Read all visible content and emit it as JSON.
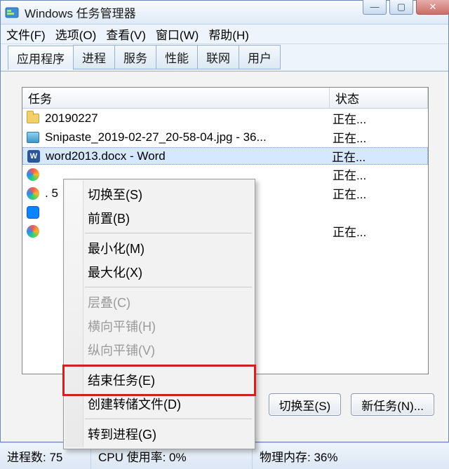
{
  "titlebar": {
    "title": "Windows 任务管理器"
  },
  "menubar": {
    "file": "文件(F)",
    "options": "选项(O)",
    "view": "查看(V)",
    "window": "窗口(W)",
    "help": "帮助(H)"
  },
  "tabs": {
    "apps": "应用程序",
    "procs": "进程",
    "services": "服务",
    "perf": "性能",
    "net": "联网",
    "users": "用户"
  },
  "columns": {
    "task": "任务",
    "state": "状态"
  },
  "rows": [
    {
      "icon": "folder",
      "task": "20190227",
      "state": "正在..."
    },
    {
      "icon": "image",
      "task": "Snipaste_2019-02-27_20-58-04.jpg - 36...",
      "state": "正在..."
    },
    {
      "icon": "word",
      "task": "word2013.docx - Word",
      "state": "正在...",
      "selected": true
    },
    {
      "icon": "colorA",
      "task": "",
      "state": "正在..."
    },
    {
      "icon": "colorA",
      "task": ". 5",
      "state": "正在..."
    },
    {
      "icon": "blue",
      "task": "",
      "state": ""
    },
    {
      "icon": "colorA",
      "task": "",
      "state": "正在..."
    }
  ],
  "context_menu": {
    "switch_to": "切换至(S)",
    "bring_front": "前置(B)",
    "minimize": "最小化(M)",
    "maximize": "最大化(X)",
    "cascade": "层叠(C)",
    "tile_h": "横向平铺(H)",
    "tile_v": "纵向平铺(V)",
    "end_task": "结束任务(E)",
    "create_dump": "创建转储文件(D)",
    "goto_proc": "转到进程(G)"
  },
  "buttons": {
    "switch_to": "切换至(S)",
    "new_task": "新任务(N)..."
  },
  "status": {
    "procs": "进程数: 75",
    "cpu": "CPU 使用率: 0%",
    "mem": "物理内存: 36%"
  }
}
